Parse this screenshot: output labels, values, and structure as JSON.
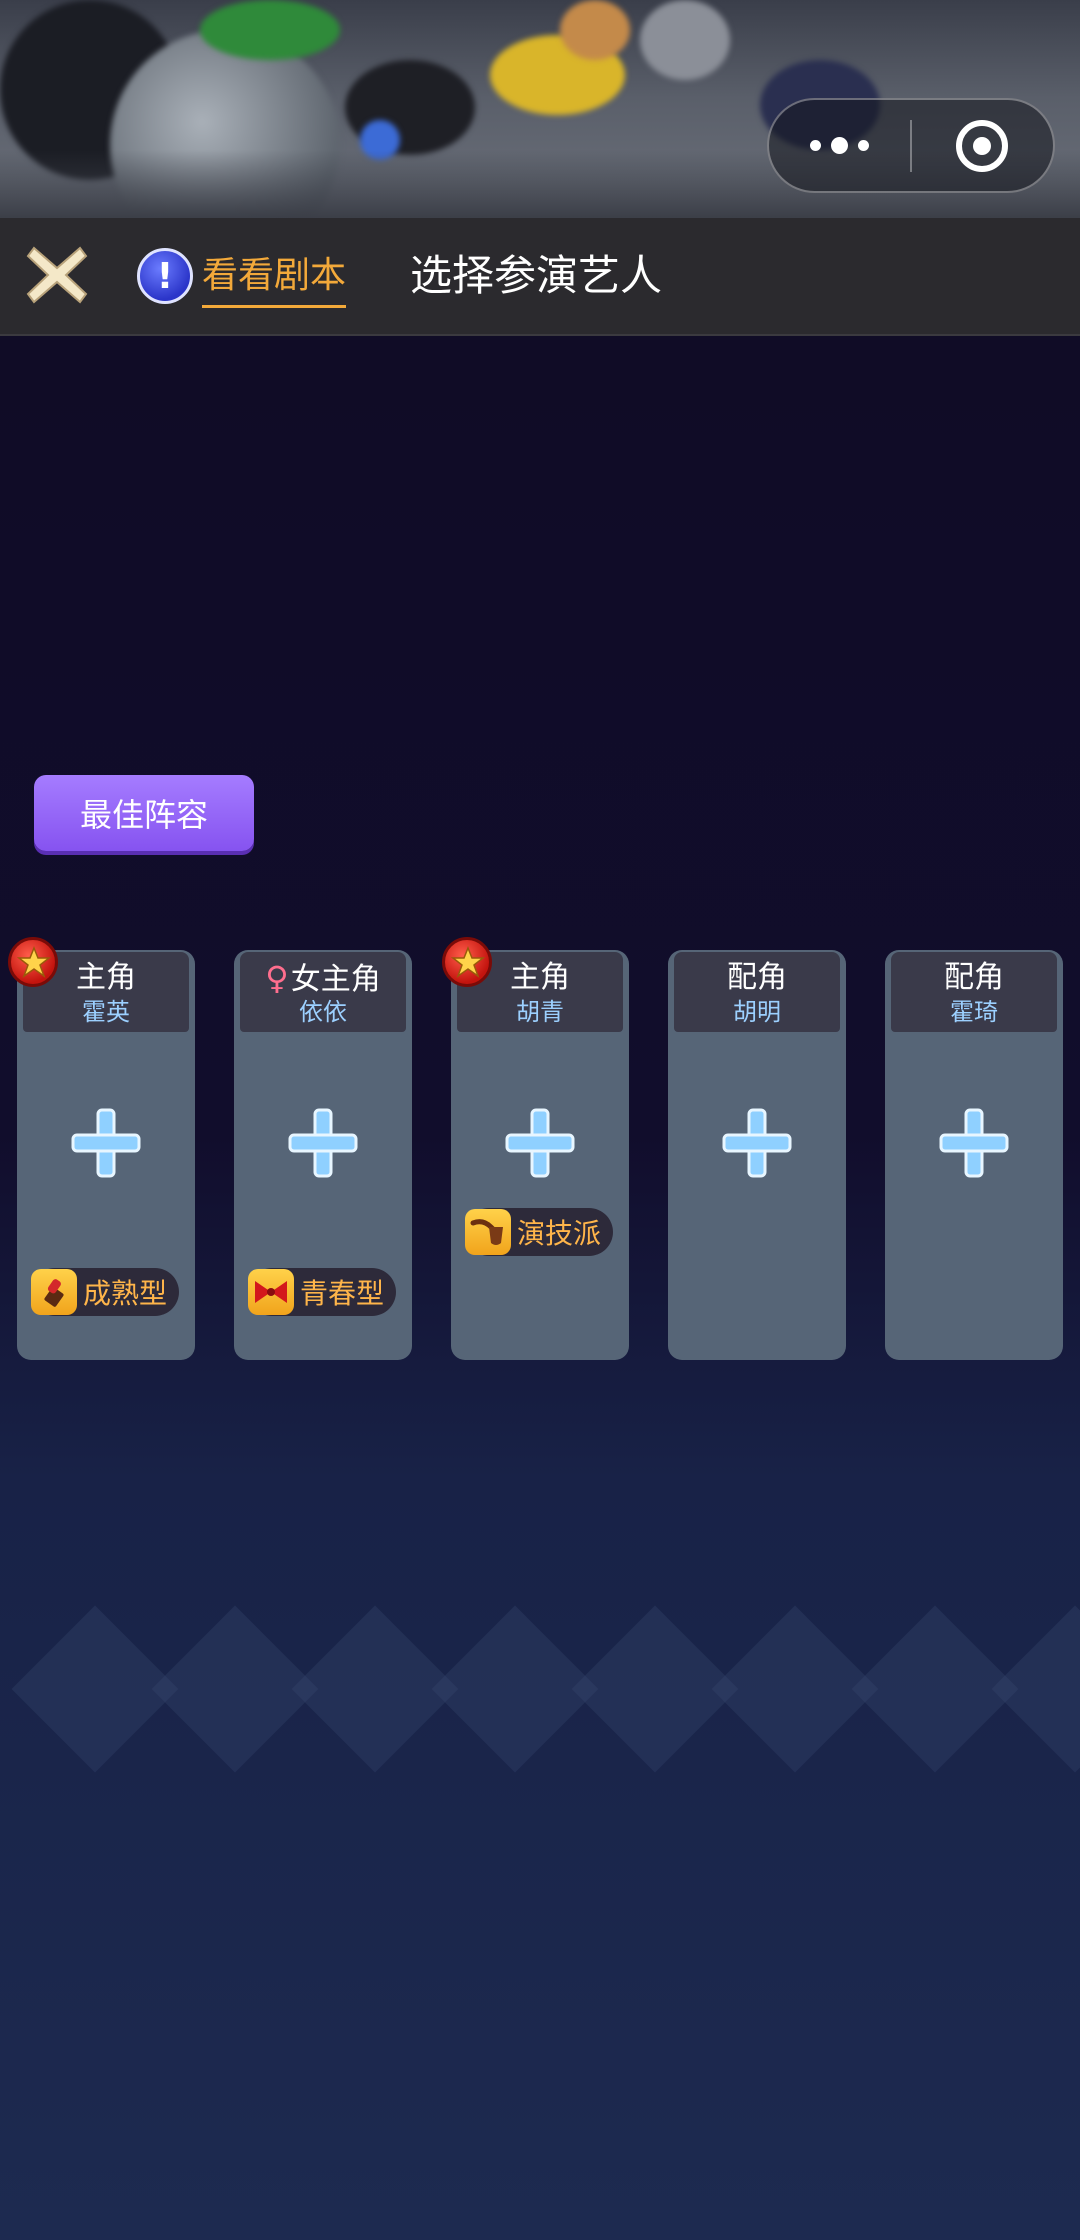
{
  "header": {
    "script_tab_label": "看看剧本",
    "title": "选择参演艺人"
  },
  "buttons": {
    "best_lineup": "最佳阵容"
  },
  "roles": [
    {
      "role": "主角",
      "actor": "霍英",
      "female_icon": false,
      "star_badge": true,
      "tag": "成熟型",
      "tag_icon": "lipstick-icon"
    },
    {
      "role": "女主角",
      "actor": "依依",
      "female_icon": true,
      "star_badge": false,
      "tag": "青春型",
      "tag_icon": "bow-icon"
    },
    {
      "role": "主角",
      "actor": "胡青",
      "female_icon": false,
      "star_badge": true,
      "tag": "演技派",
      "tag_icon": "pipe-icon"
    },
    {
      "role": "配角",
      "actor": "胡明",
      "female_icon": false,
      "star_badge": false,
      "tag": "",
      "tag_icon": ""
    },
    {
      "role": "配角",
      "actor": "霍琦",
      "female_icon": false,
      "star_badge": false,
      "tag": "",
      "tag_icon": ""
    }
  ],
  "colors": {
    "accent_orange": "#f3a93a",
    "button_purple": "#8653f0",
    "card_slate": "#566577",
    "plus_blue": "#8fd0ff"
  }
}
